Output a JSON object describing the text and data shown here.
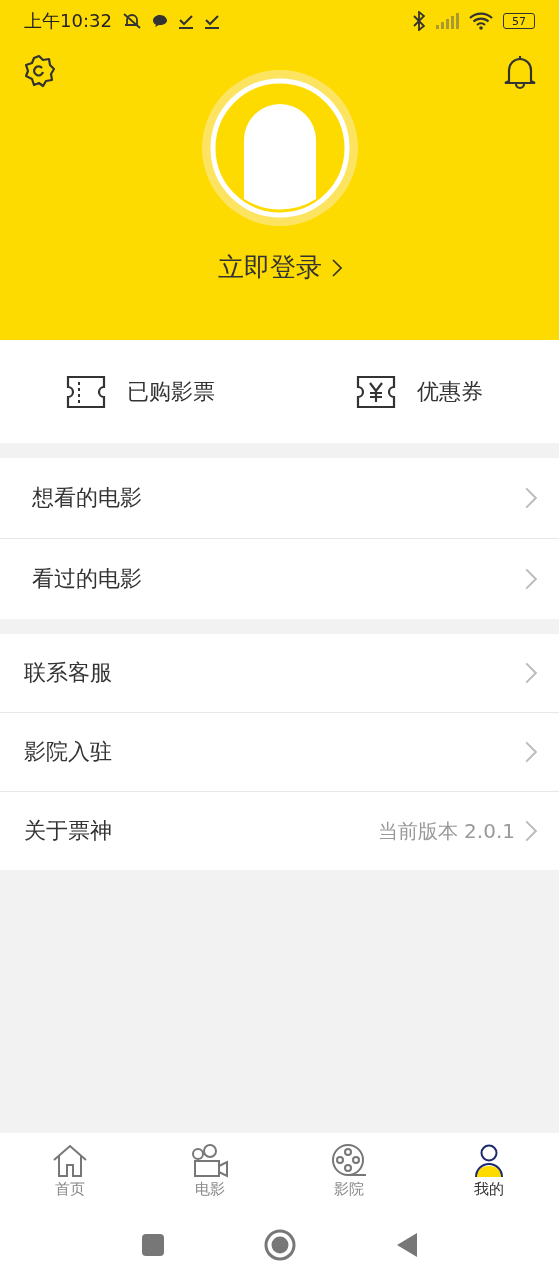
{
  "status_bar": {
    "time": "上午10:32",
    "battery": "57"
  },
  "header": {
    "login": "立即登录"
  },
  "quick_links": [
    {
      "kind": "ticket",
      "label": "已购影票"
    },
    {
      "kind": "coupon",
      "label": "优惠券"
    }
  ],
  "menu_groups": [
    {
      "items": [
        {
          "label": "想看的电影"
        },
        {
          "label": "看过的电影"
        }
      ]
    },
    {
      "items": [
        {
          "label": "联系客服"
        },
        {
          "label": "影院入驻"
        },
        {
          "label": "关于票神",
          "value": "当前版本 2.0.1"
        }
      ]
    }
  ],
  "tabs": [
    {
      "kind": "home",
      "label": "首页",
      "selected": false
    },
    {
      "kind": "movie",
      "label": "电影",
      "selected": false
    },
    {
      "kind": "cinema",
      "label": "影院",
      "selected": false
    },
    {
      "kind": "me",
      "label": "我的",
      "selected": true
    }
  ]
}
